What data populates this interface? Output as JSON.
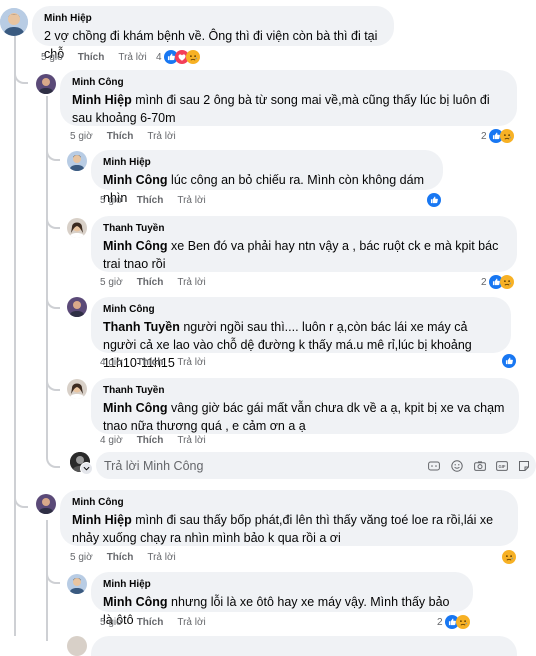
{
  "comments": [
    {
      "author": "Minh Hiệp",
      "text": "2 vợ chồng đi khám bệnh về. Ông thì đi viện còn bà thì đi tại chỗ",
      "time": "5 giờ",
      "like": "Thích",
      "reply": "Trả lời",
      "reaction_count": "4",
      "reactions": [
        "like-icon",
        "love-icon",
        "sad-icon"
      ]
    },
    {
      "author": "Minh Công",
      "tag": "Minh Hiệp",
      "text": " mình đi sau 2 ông bà từ song mai về,mà cũng thấy lúc bị luôn đi sau khoảng 6-70m",
      "time": "5 giờ",
      "like": "Thích",
      "reply": "Trả lời",
      "reaction_count": "2",
      "reactions": [
        "like-icon",
        "sad-icon"
      ]
    },
    {
      "author": "Minh Hiệp",
      "tag": "Minh Công",
      "text": " lúc công an bỏ chiếu ra. Mình còn không dám nhìn",
      "time": "5 giờ",
      "like": "Thích",
      "reply": "Trả lời",
      "reaction_count": "",
      "reactions": [
        "like-icon"
      ]
    },
    {
      "author": "Thanh Tuyền",
      "tag": "Minh Công",
      "text": " xe Ben đó va phải hay ntn vậy a , bác ruột ck e mà kpit bác trai tnao rồi",
      "time": "5 giờ",
      "like": "Thích",
      "reply": "Trả lời",
      "reaction_count": "2",
      "reactions": [
        "like-icon",
        "sad-icon"
      ]
    },
    {
      "author": "Minh Công",
      "tag": "Thanh Tuyền",
      "text": " người ngồi sau thì.... luôn r ạ,còn bác lái xe máy cả người cả xe lao vào chỗ dệ đường k thấy má.u mê rỉ,lúc bị khoảng 11h10-11h15",
      "time": "4 giờ",
      "like": "Thích",
      "reply": "Trả lời",
      "reaction_count": "",
      "reactions": [
        "like-icon"
      ]
    },
    {
      "author": "Thanh Tuyền",
      "tag": "Minh Công",
      "text": " vâng giờ bác gái mất vẫn chưa dk về a ạ, kpit bị xe va chạm tnao nữa thương quá , e cảm ơn a ạ",
      "time": "4 giờ",
      "like": "Thích",
      "reply": "Trả lời",
      "reaction_count": "",
      "reactions": []
    },
    {
      "author": "Minh Công",
      "tag": "Minh Hiệp",
      "text": " mình đi sau thấy bốp phát,đi lên thì thấy văng toé loe ra rồi,lái xe nhảy xuống chạy ra nhìn mình bảo k qua rồi a ơi",
      "time": "5 giờ",
      "like": "Thích",
      "reply": "Trả lời",
      "reaction_count": "",
      "reactions": [
        "sad-icon"
      ]
    },
    {
      "author": "Minh Hiệp",
      "tag": "Minh Công",
      "text": " nhưng lỗi là xe ôtô hay xe máy vậy. Mình thấy bảo là ôtô",
      "time": "5 giờ",
      "like": "Thích",
      "reply": "Trả lời",
      "reaction_count": "2",
      "reactions": [
        "like-icon",
        "sad-icon"
      ]
    }
  ],
  "reply_box": {
    "placeholder": "Trả lời Minh Công",
    "tools": [
      "emoji-icon",
      "smile-icon",
      "camera-icon",
      "gif-icon",
      "sticker-icon"
    ]
  },
  "colors": {
    "like": "#1877f2",
    "sad": "#f7b125",
    "love": "#f33e58",
    "meta": "#65676b",
    "bubble": "#f0f2f5"
  }
}
